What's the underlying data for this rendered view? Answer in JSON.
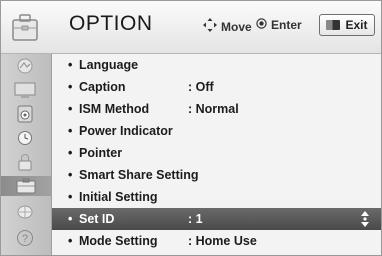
{
  "header": {
    "title": "OPTION",
    "move_label": "Move",
    "enter_label": "Enter",
    "exit_label": "Exit",
    "icon": "option-suitcase-icon"
  },
  "sidebar": {
    "items": [
      {
        "icon": "picture-icon"
      },
      {
        "icon": "audio-screen-icon"
      },
      {
        "icon": "speaker-icon"
      },
      {
        "icon": "clock-icon"
      },
      {
        "icon": "lock-icon"
      },
      {
        "icon": "option-icon",
        "active": true
      },
      {
        "icon": "network-globe-icon"
      },
      {
        "icon": "help-icon"
      }
    ]
  },
  "menu": {
    "items": [
      {
        "label": "Language",
        "value": ""
      },
      {
        "label": "Caption",
        "value": ": Off"
      },
      {
        "label": "ISM Method",
        "value": ": Normal"
      },
      {
        "label": "Power Indicator",
        "value": ""
      },
      {
        "label": "Pointer",
        "value": ""
      },
      {
        "label": "Smart Share Setting",
        "value": ""
      },
      {
        "label": "Initial Setting",
        "value": ""
      },
      {
        "label": "Set ID",
        "value": ": 1",
        "selected": true
      },
      {
        "label": "Mode Setting",
        "value": ": Home Use"
      }
    ],
    "bullet": "•"
  },
  "colors": {
    "selected_row": "#555555",
    "header_bg": "#f0f0f0",
    "sidebar_bg": "#c8c8c8"
  }
}
